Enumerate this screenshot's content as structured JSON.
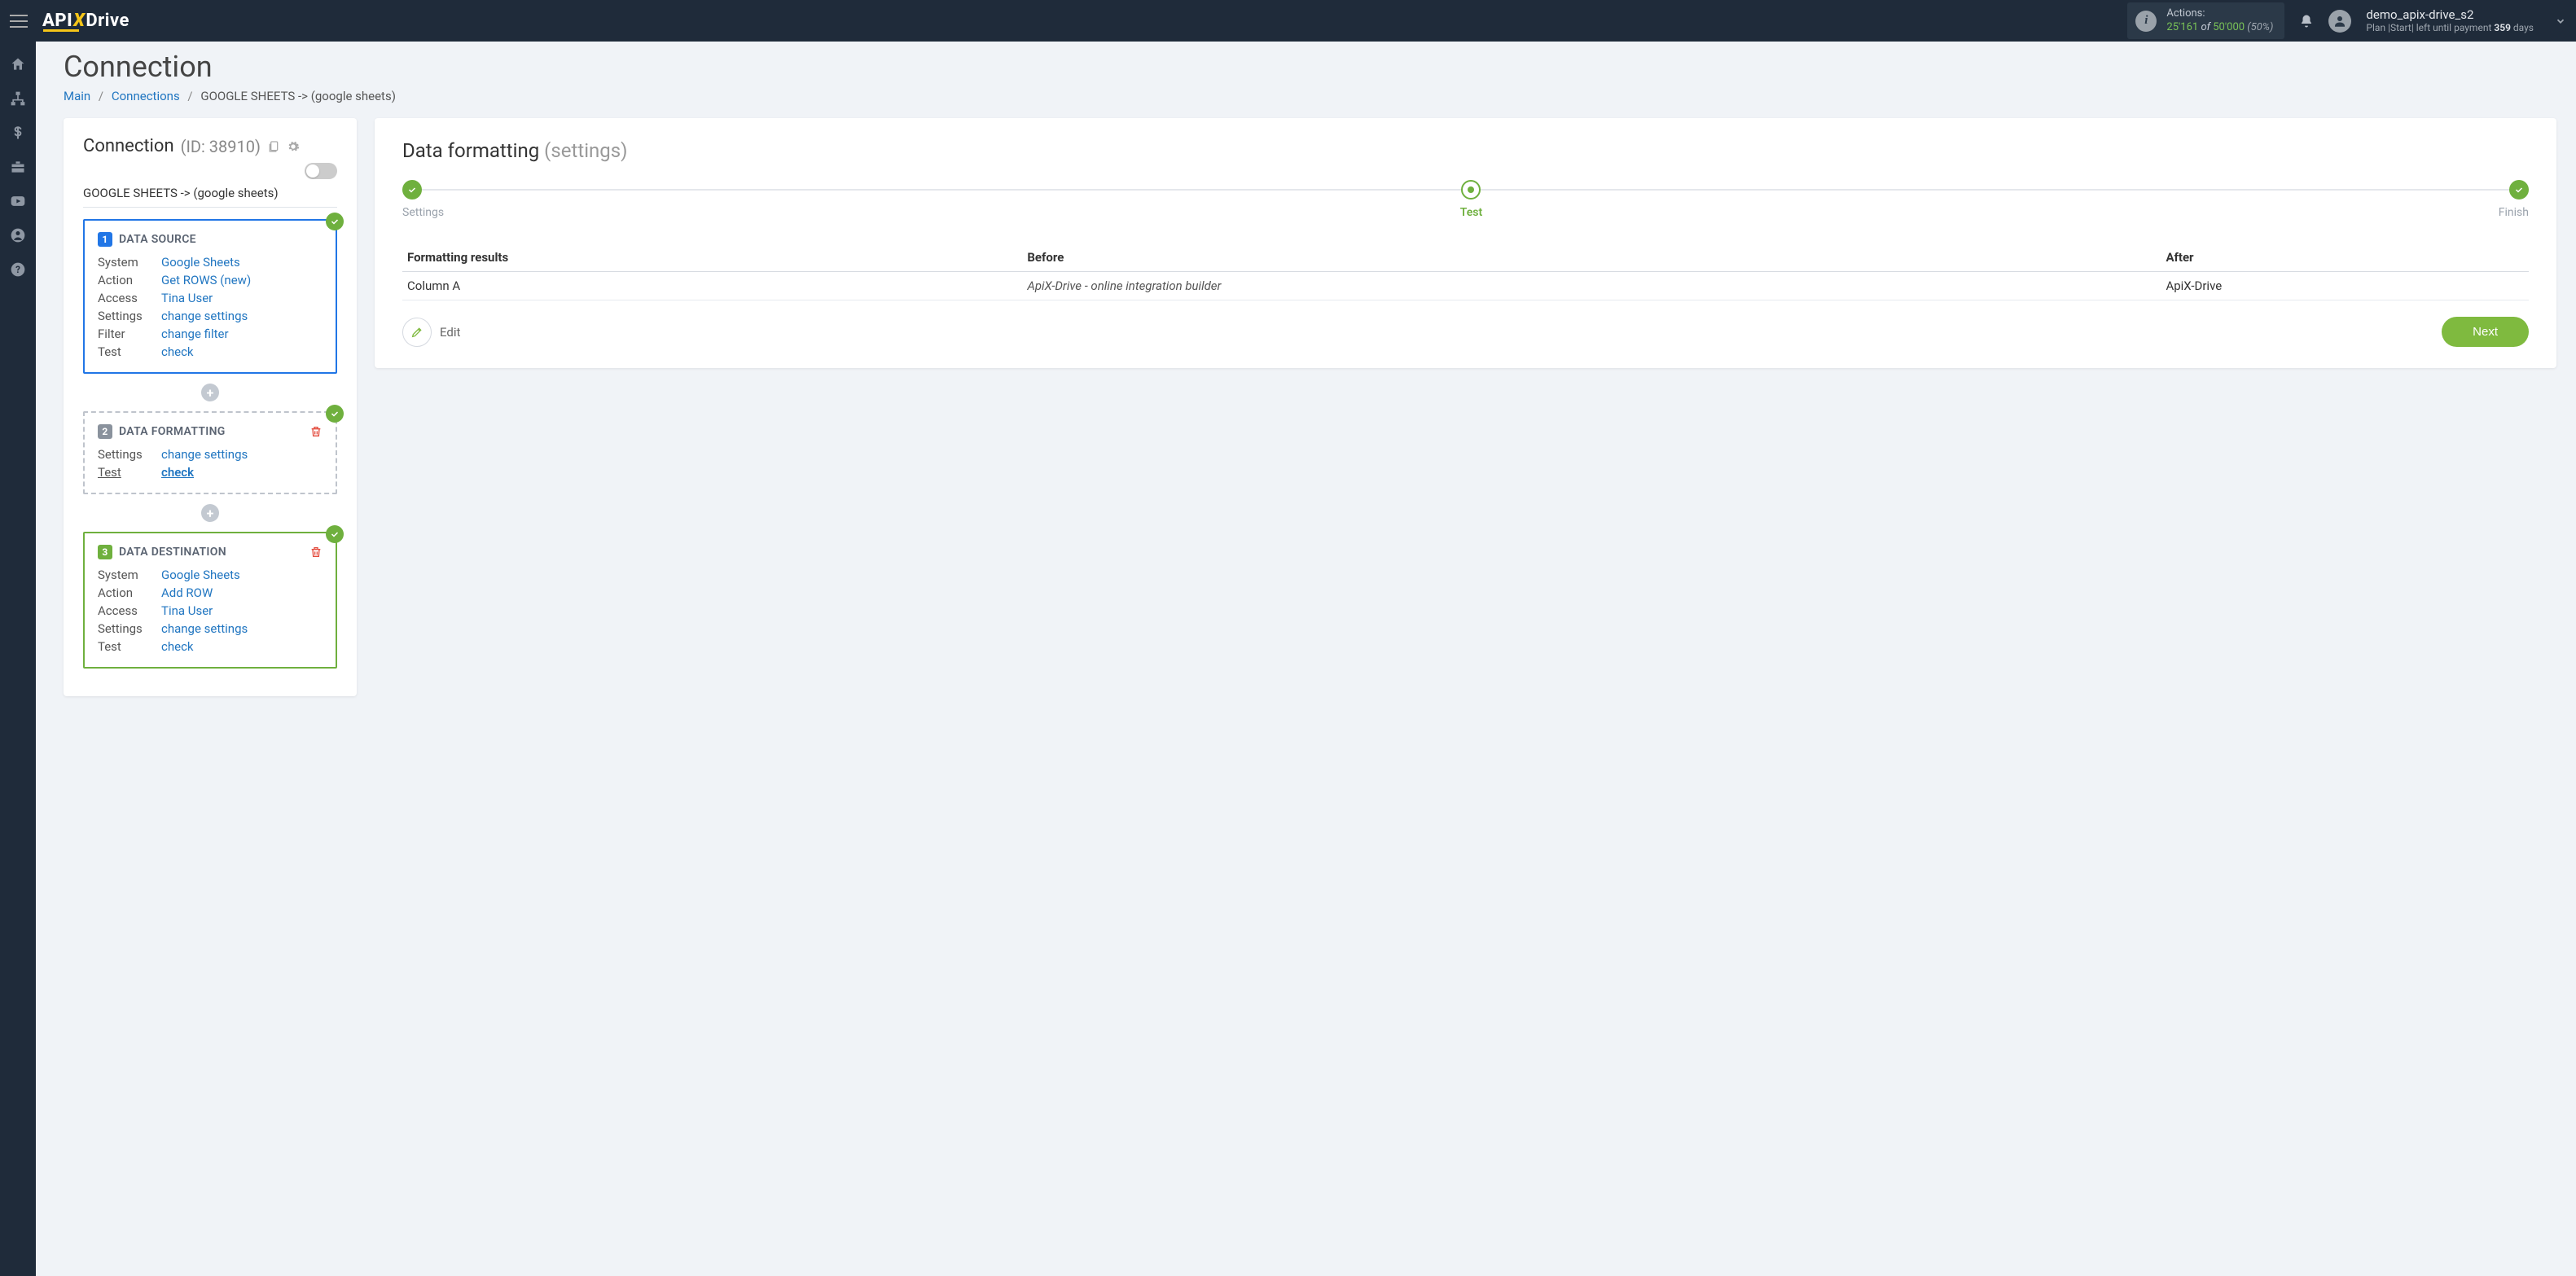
{
  "topbar": {
    "actions_label": "Actions:",
    "actions_used": "25'161",
    "actions_of": "of",
    "actions_total": "50'000",
    "actions_pct": "(50%)",
    "user_name": "demo_apix-drive_s2",
    "plan_prefix": "Plan |Start| left until payment ",
    "plan_days": "359",
    "plan_suffix": " days"
  },
  "page": {
    "title": "Connection",
    "breadcrumb_main": "Main",
    "breadcrumb_connections": "Connections",
    "breadcrumb_current": "GOOGLE SHEETS -> (google sheets)"
  },
  "connection": {
    "heading": "Connection",
    "id_label": "(ID: 38910)",
    "path": "GOOGLE SHEETS -> (google sheets)"
  },
  "steps": {
    "source": {
      "num": "1",
      "title": "DATA SOURCE",
      "rows": [
        {
          "label": "System",
          "value": "Google Sheets"
        },
        {
          "label": "Action",
          "value": "Get ROWS (new)"
        },
        {
          "label": "Access",
          "value": "Tina User"
        },
        {
          "label": "Settings",
          "value": "change settings"
        },
        {
          "label": "Filter",
          "value": "change filter"
        },
        {
          "label": "Test",
          "value": "check"
        }
      ]
    },
    "formatting": {
      "num": "2",
      "title": "DATA FORMATTING",
      "rows": [
        {
          "label": "Settings",
          "value": "change settings"
        },
        {
          "label": "Test",
          "value": "check",
          "active": true
        }
      ]
    },
    "dest": {
      "num": "3",
      "title": "DATA DESTINATION",
      "rows": [
        {
          "label": "System",
          "value": "Google Sheets"
        },
        {
          "label": "Action",
          "value": "Add ROW"
        },
        {
          "label": "Access",
          "value": "Tina User"
        },
        {
          "label": "Settings",
          "value": "change settings"
        },
        {
          "label": "Test",
          "value": "check"
        }
      ]
    }
  },
  "right": {
    "title": "Data formatting",
    "title_sub": "(settings)",
    "stepper": {
      "settings": "Settings",
      "test": "Test",
      "finish": "Finish"
    },
    "table": {
      "col_results": "Formatting results",
      "col_before": "Before",
      "col_after": "After",
      "rows": [
        {
          "results": "Column A",
          "before": "ApiX-Drive - online integration builder",
          "after": "ApiX-Drive"
        }
      ]
    },
    "edit_label": "Edit",
    "next_label": "Next"
  }
}
